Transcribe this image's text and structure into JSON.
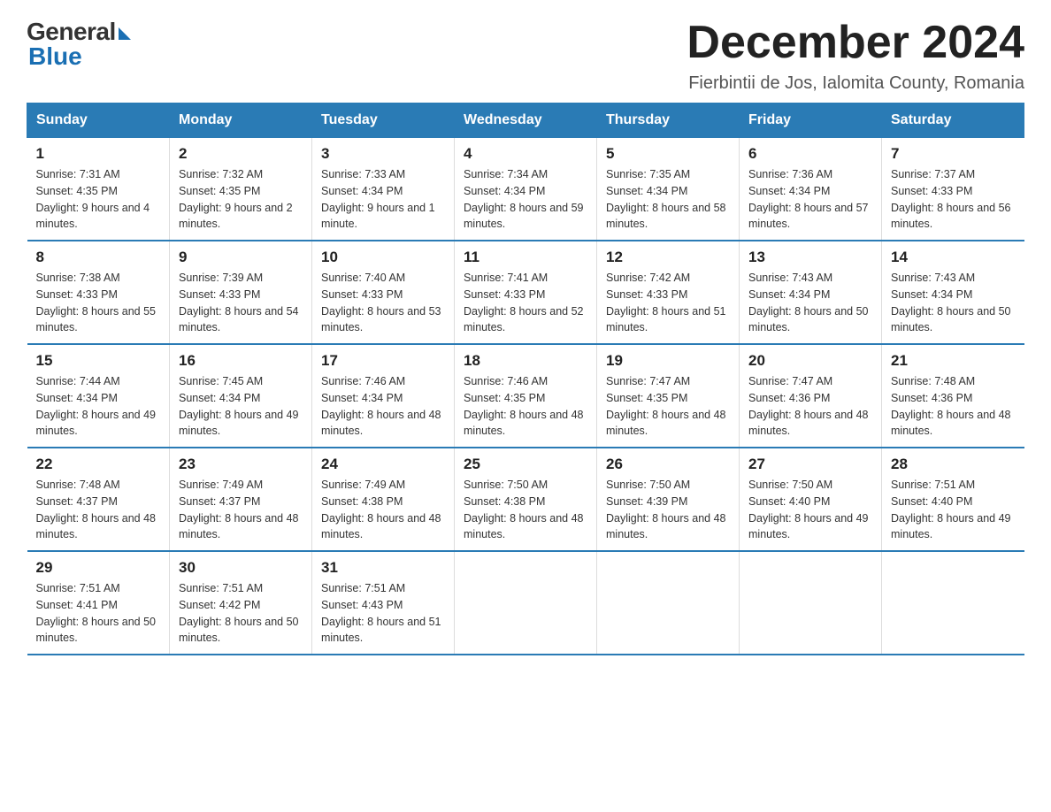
{
  "logo": {
    "general": "General",
    "blue": "Blue"
  },
  "title": "December 2024",
  "subtitle": "Fierbintii de Jos, Ialomita County, Romania",
  "days_of_week": [
    "Sunday",
    "Monday",
    "Tuesday",
    "Wednesday",
    "Thursday",
    "Friday",
    "Saturday"
  ],
  "weeks": [
    [
      {
        "day": "1",
        "sunrise": "7:31 AM",
        "sunset": "4:35 PM",
        "daylight": "9 hours and 4 minutes."
      },
      {
        "day": "2",
        "sunrise": "7:32 AM",
        "sunset": "4:35 PM",
        "daylight": "9 hours and 2 minutes."
      },
      {
        "day": "3",
        "sunrise": "7:33 AM",
        "sunset": "4:34 PM",
        "daylight": "9 hours and 1 minute."
      },
      {
        "day": "4",
        "sunrise": "7:34 AM",
        "sunset": "4:34 PM",
        "daylight": "8 hours and 59 minutes."
      },
      {
        "day": "5",
        "sunrise": "7:35 AM",
        "sunset": "4:34 PM",
        "daylight": "8 hours and 58 minutes."
      },
      {
        "day": "6",
        "sunrise": "7:36 AM",
        "sunset": "4:34 PM",
        "daylight": "8 hours and 57 minutes."
      },
      {
        "day": "7",
        "sunrise": "7:37 AM",
        "sunset": "4:33 PM",
        "daylight": "8 hours and 56 minutes."
      }
    ],
    [
      {
        "day": "8",
        "sunrise": "7:38 AM",
        "sunset": "4:33 PM",
        "daylight": "8 hours and 55 minutes."
      },
      {
        "day": "9",
        "sunrise": "7:39 AM",
        "sunset": "4:33 PM",
        "daylight": "8 hours and 54 minutes."
      },
      {
        "day": "10",
        "sunrise": "7:40 AM",
        "sunset": "4:33 PM",
        "daylight": "8 hours and 53 minutes."
      },
      {
        "day": "11",
        "sunrise": "7:41 AM",
        "sunset": "4:33 PM",
        "daylight": "8 hours and 52 minutes."
      },
      {
        "day": "12",
        "sunrise": "7:42 AM",
        "sunset": "4:33 PM",
        "daylight": "8 hours and 51 minutes."
      },
      {
        "day": "13",
        "sunrise": "7:43 AM",
        "sunset": "4:34 PM",
        "daylight": "8 hours and 50 minutes."
      },
      {
        "day": "14",
        "sunrise": "7:43 AM",
        "sunset": "4:34 PM",
        "daylight": "8 hours and 50 minutes."
      }
    ],
    [
      {
        "day": "15",
        "sunrise": "7:44 AM",
        "sunset": "4:34 PM",
        "daylight": "8 hours and 49 minutes."
      },
      {
        "day": "16",
        "sunrise": "7:45 AM",
        "sunset": "4:34 PM",
        "daylight": "8 hours and 49 minutes."
      },
      {
        "day": "17",
        "sunrise": "7:46 AM",
        "sunset": "4:34 PM",
        "daylight": "8 hours and 48 minutes."
      },
      {
        "day": "18",
        "sunrise": "7:46 AM",
        "sunset": "4:35 PM",
        "daylight": "8 hours and 48 minutes."
      },
      {
        "day": "19",
        "sunrise": "7:47 AM",
        "sunset": "4:35 PM",
        "daylight": "8 hours and 48 minutes."
      },
      {
        "day": "20",
        "sunrise": "7:47 AM",
        "sunset": "4:36 PM",
        "daylight": "8 hours and 48 minutes."
      },
      {
        "day": "21",
        "sunrise": "7:48 AM",
        "sunset": "4:36 PM",
        "daylight": "8 hours and 48 minutes."
      }
    ],
    [
      {
        "day": "22",
        "sunrise": "7:48 AM",
        "sunset": "4:37 PM",
        "daylight": "8 hours and 48 minutes."
      },
      {
        "day": "23",
        "sunrise": "7:49 AM",
        "sunset": "4:37 PM",
        "daylight": "8 hours and 48 minutes."
      },
      {
        "day": "24",
        "sunrise": "7:49 AM",
        "sunset": "4:38 PM",
        "daylight": "8 hours and 48 minutes."
      },
      {
        "day": "25",
        "sunrise": "7:50 AM",
        "sunset": "4:38 PM",
        "daylight": "8 hours and 48 minutes."
      },
      {
        "day": "26",
        "sunrise": "7:50 AM",
        "sunset": "4:39 PM",
        "daylight": "8 hours and 48 minutes."
      },
      {
        "day": "27",
        "sunrise": "7:50 AM",
        "sunset": "4:40 PM",
        "daylight": "8 hours and 49 minutes."
      },
      {
        "day": "28",
        "sunrise": "7:51 AM",
        "sunset": "4:40 PM",
        "daylight": "8 hours and 49 minutes."
      }
    ],
    [
      {
        "day": "29",
        "sunrise": "7:51 AM",
        "sunset": "4:41 PM",
        "daylight": "8 hours and 50 minutes."
      },
      {
        "day": "30",
        "sunrise": "7:51 AM",
        "sunset": "4:42 PM",
        "daylight": "8 hours and 50 minutes."
      },
      {
        "day": "31",
        "sunrise": "7:51 AM",
        "sunset": "4:43 PM",
        "daylight": "8 hours and 51 minutes."
      },
      null,
      null,
      null,
      null
    ]
  ],
  "labels": {
    "sunrise": "Sunrise:",
    "sunset": "Sunset:",
    "daylight": "Daylight:"
  }
}
